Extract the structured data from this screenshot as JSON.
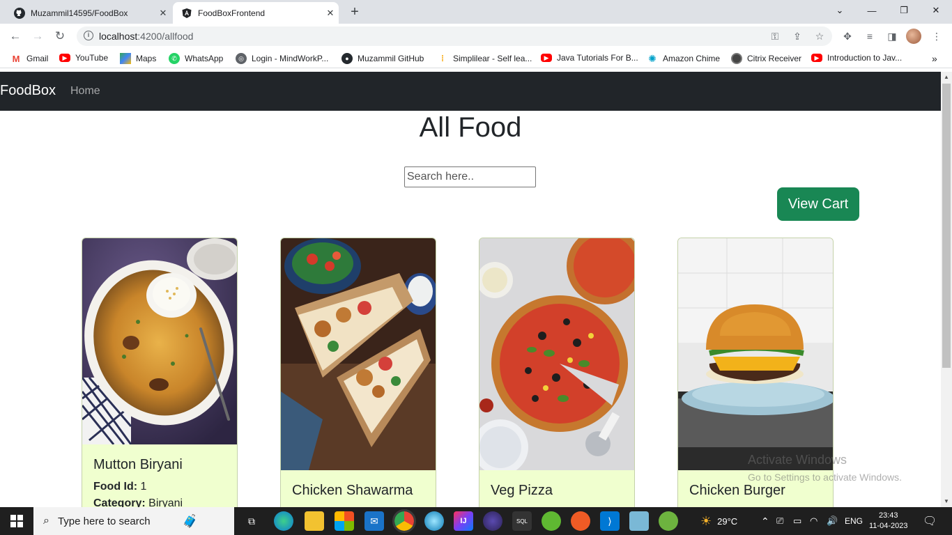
{
  "browser": {
    "tabs": [
      {
        "title": "Muzammil14595/FoodBox",
        "active": false,
        "icon": "github-icon"
      },
      {
        "title": "FoodBoxFrontend",
        "active": true,
        "icon": "angular-icon"
      }
    ],
    "url_host": "localhost",
    "url_path": ":4200/allfood",
    "bookmarks": [
      {
        "label": "Gmail",
        "icon": "gmail-icon"
      },
      {
        "label": "YouTube",
        "icon": "youtube-icon"
      },
      {
        "label": "Maps",
        "icon": "maps-icon"
      },
      {
        "label": "WhatsApp",
        "icon": "whatsapp-icon"
      },
      {
        "label": "Login - MindWorkP...",
        "icon": "globe-icon"
      },
      {
        "label": "Muzammil GitHub",
        "icon": "github-icon"
      },
      {
        "label": "Simplilear - Self lea...",
        "icon": "simplilearn-icon"
      },
      {
        "label": "Java Tutorials For B...",
        "icon": "youtube-icon"
      },
      {
        "label": "Amazon Chime",
        "icon": "chime-icon"
      },
      {
        "label": "Citrix Receiver",
        "icon": "citrix-icon"
      },
      {
        "label": "Introduction to Jav...",
        "icon": "youtube-icon"
      }
    ]
  },
  "app": {
    "brand": "FoodBox",
    "nav": {
      "home": "Home"
    },
    "heading": "All Food",
    "search_placeholder": "Search here..",
    "view_cart": "View Cart",
    "labels": {
      "food_id": "Food Id:",
      "category": "Category:"
    },
    "foods": [
      {
        "name": "Mutton Biryani",
        "food_id": "1",
        "category": "Biryani"
      },
      {
        "name": "Chicken Shawarma"
      },
      {
        "name": "Veg Pizza"
      },
      {
        "name": "Chicken Burger"
      }
    ]
  },
  "watermark": {
    "line1": "Activate Windows",
    "line2": "Go to Settings to activate Windows."
  },
  "taskbar": {
    "search_placeholder": "Type here to search",
    "weather": "29°C",
    "language": "ENG",
    "time": "23:43",
    "date": "11-04-2023"
  },
  "colors": {
    "navbar": "#212529",
    "card_body": "#f0ffcf",
    "view_cart": "#198754"
  }
}
